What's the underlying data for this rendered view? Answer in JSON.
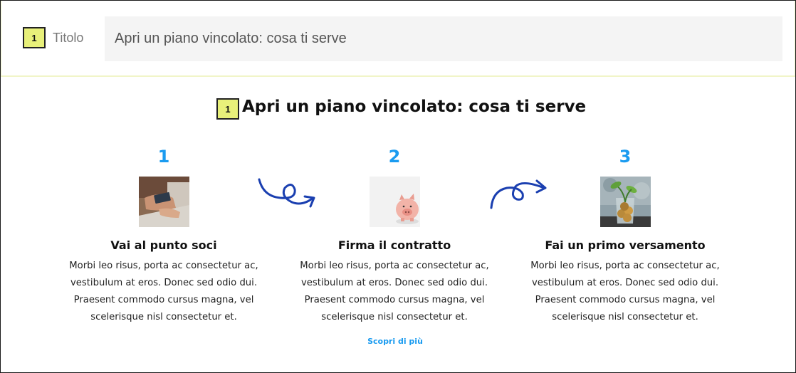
{
  "editor": {
    "badge": "1",
    "field_label": "Titolo",
    "title_value": "Apri un piano vincolato: cosa ti serve"
  },
  "heading": {
    "badge": "1",
    "text": "Apri un piano vincolato: cosa ti serve"
  },
  "steps": [
    {
      "number": "1",
      "image": "credit-card-laptop-photo",
      "title": "Vai al punto soci",
      "text": "Morbi leo risus, porta ac consectetur ac, vestibulum at eros. Donec sed odio dui. Praesent commodo cursus magna, vel scelerisque nisl consectetur et."
    },
    {
      "number": "2",
      "image": "piggy-bank-photo",
      "title": "Firma il contratto",
      "text": "Morbi leo risus, porta ac consectetur ac, vestibulum at eros. Donec sed odio dui. Praesent commodo cursus magna, vel scelerisque nisl consectetur et."
    },
    {
      "number": "3",
      "image": "coins-jar-plant-photo",
      "title": "Fai un primo versamento",
      "text": "Morbi leo risus, porta ac consectetur ac, vestibulum at eros. Donec sed odio dui. Praesent commodo cursus magna, vel scelerisque nisl consectetur et."
    }
  ],
  "link": {
    "label": "Scopri di più"
  },
  "colors": {
    "accent": "#1a9bf0",
    "arrow": "#1a3fb0",
    "badge": "#e8f07a",
    "input_bg": "#f4f4f4"
  }
}
